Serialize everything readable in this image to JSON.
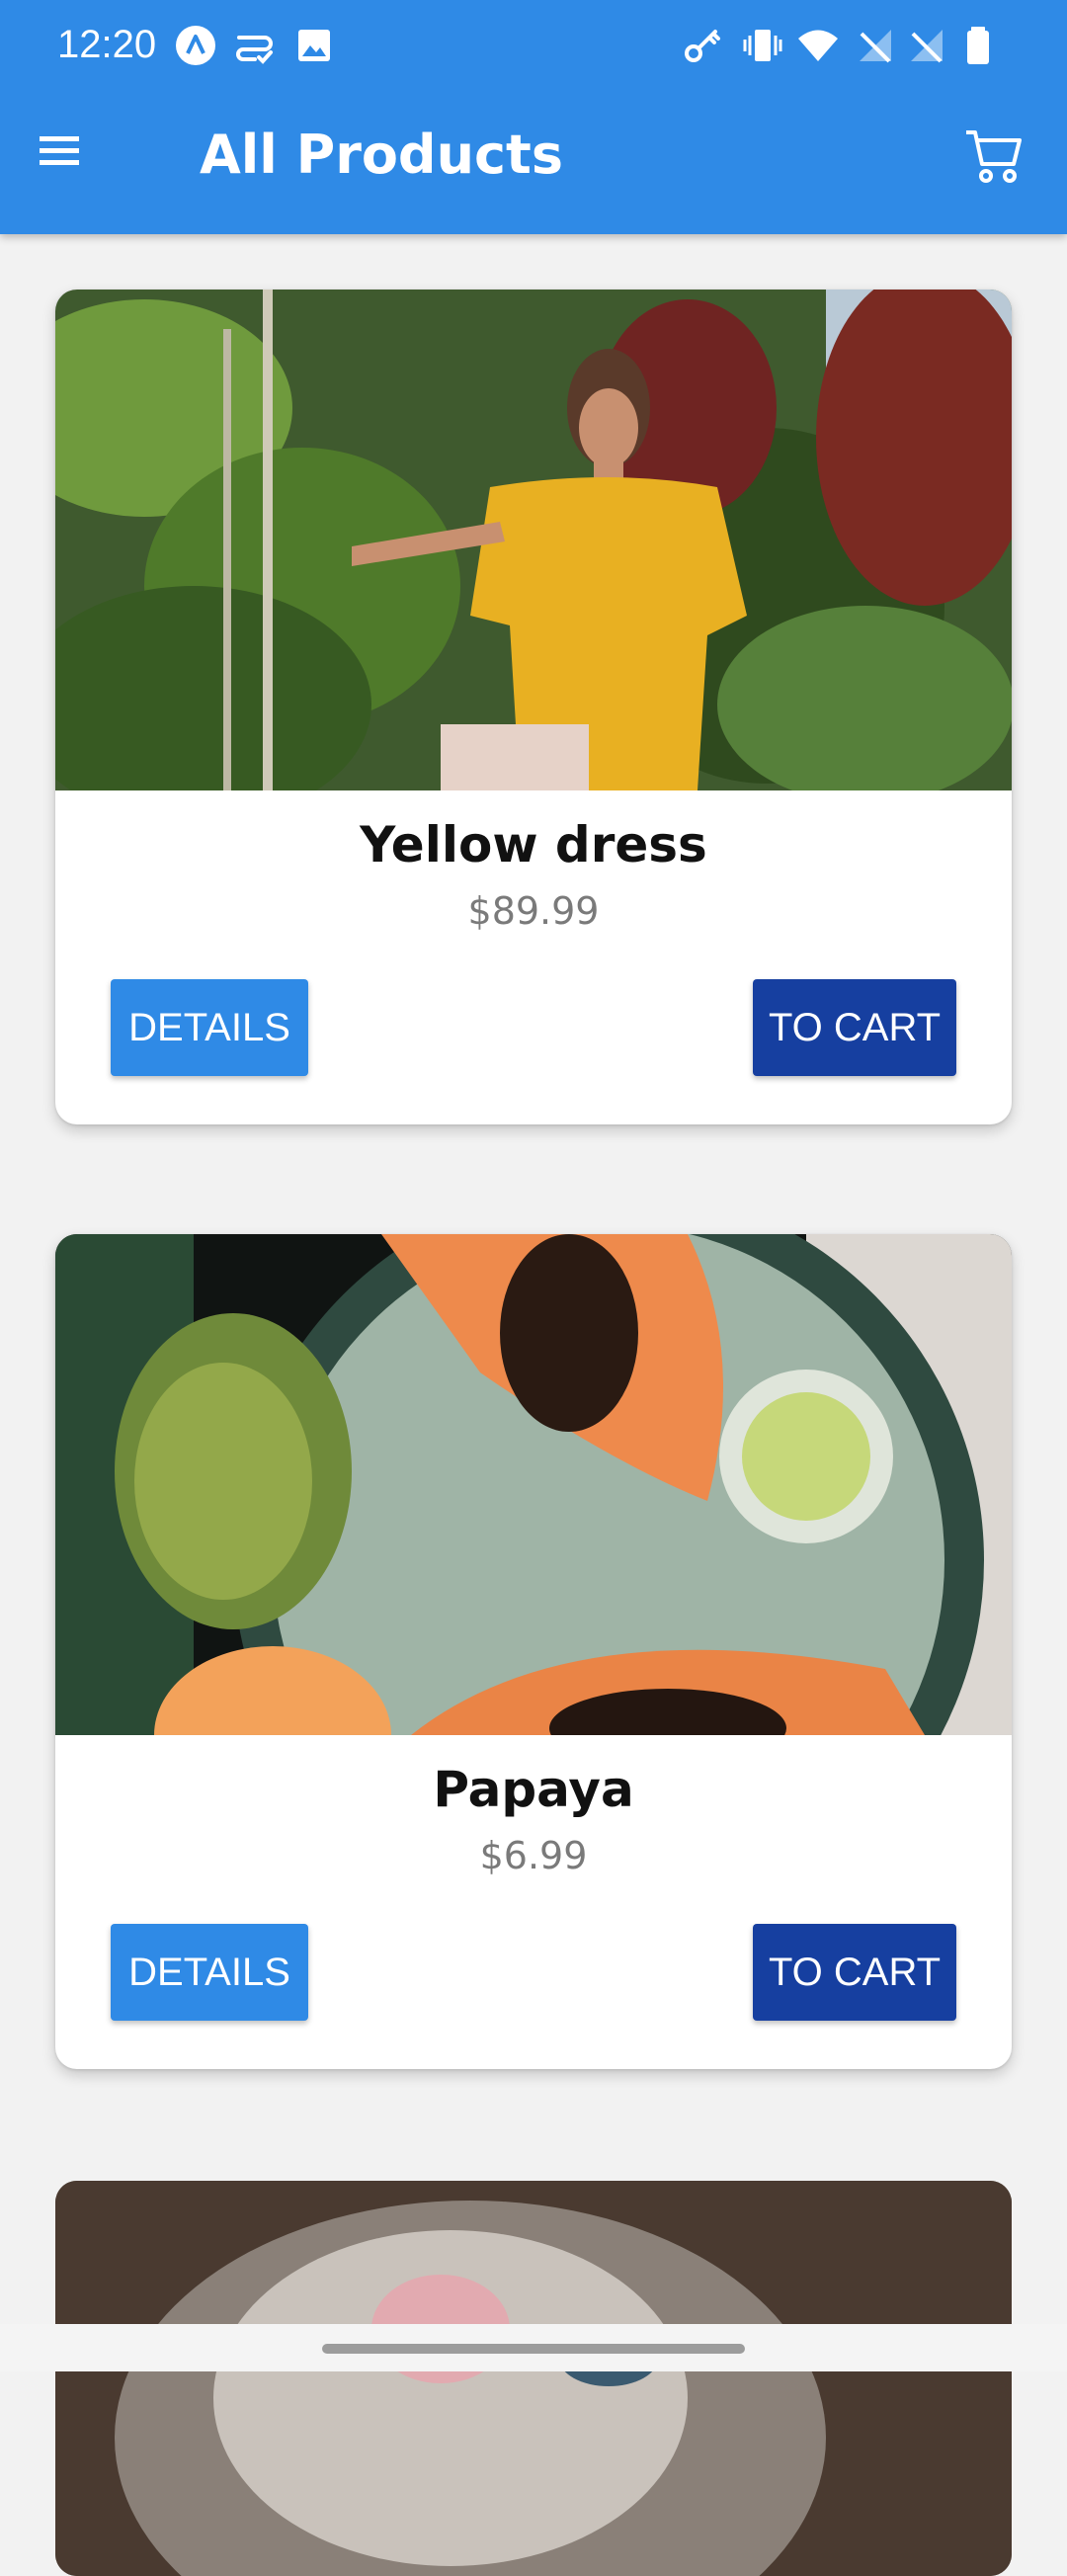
{
  "status_bar": {
    "time": "12:20",
    "left_icons": [
      "app-a-icon",
      "sync-check-icon",
      "image-icon"
    ],
    "right_icons": [
      "key-icon",
      "vibrate-icon",
      "wifi-icon",
      "no-signal-icon",
      "no-signal-icon",
      "battery-icon"
    ]
  },
  "app_bar": {
    "title": "All Products",
    "menu_icon": "menu-icon",
    "cart_icon": "shopping-cart-icon",
    "background": "#2f8ae6"
  },
  "products": [
    {
      "name": "Yellow dress",
      "price": "$89.99",
      "details_label": "DETAILS",
      "cart_label": "TO CART",
      "image": "woman-in-yellow-dress-photo"
    },
    {
      "name": "Papaya",
      "price": "$6.99",
      "details_label": "DETAILS",
      "cart_label": "TO CART",
      "image": "papaya-fruit-photo"
    },
    {
      "image": "cat-photo"
    }
  ],
  "colors": {
    "details_button": "#2f8ae6",
    "cart_button": "#163fa0",
    "price": "#7a7a7a"
  }
}
